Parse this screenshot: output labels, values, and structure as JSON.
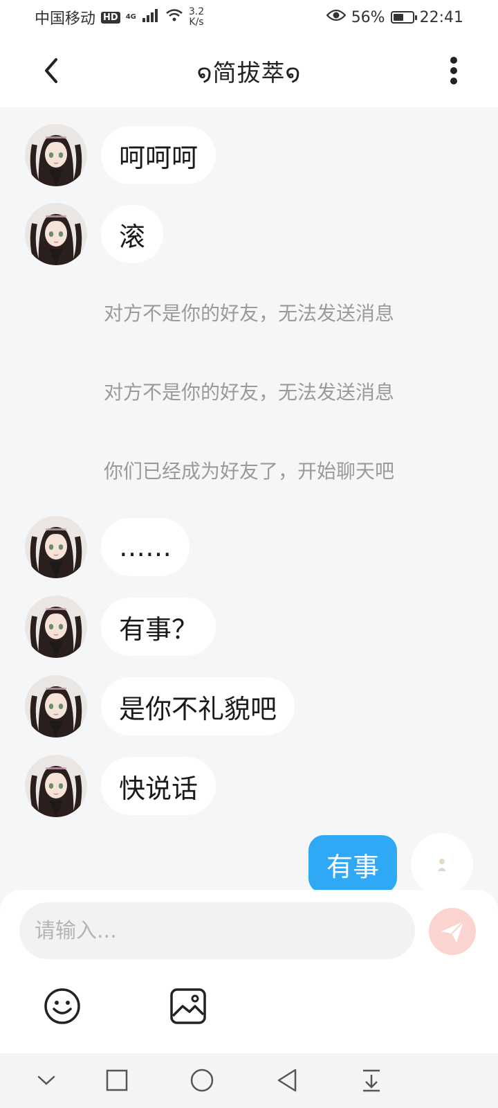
{
  "status_bar": {
    "carrier": "中国移动",
    "hd": "HD",
    "network": "4G",
    "speed_value": "3.2",
    "speed_unit": "K/s",
    "battery": "56%",
    "battery_level": 0.56,
    "time": "22:41"
  },
  "header": {
    "title": "໑简拔萃໑"
  },
  "messages": [
    {
      "type": "incoming",
      "text": "呵呵呵"
    },
    {
      "type": "incoming",
      "text": "滚"
    },
    {
      "type": "system",
      "text": "对方不是你的好友，无法发送消息"
    },
    {
      "type": "system",
      "text": "对方不是你的好友，无法发送消息"
    },
    {
      "type": "system",
      "text": "你们已经成为好友了，开始聊天吧"
    },
    {
      "type": "incoming",
      "text": "……"
    },
    {
      "type": "incoming",
      "text": "有事？"
    },
    {
      "type": "incoming",
      "text": "是你不礼貌吧"
    },
    {
      "type": "incoming",
      "text": "快说话"
    },
    {
      "type": "outgoing",
      "text": "有事"
    }
  ],
  "input": {
    "placeholder": "请输入..."
  },
  "icons": {
    "back": "chevron-left-icon",
    "more": "more-vertical-icon",
    "send": "send-icon",
    "emoji": "smiley-icon",
    "image": "image-icon",
    "nav_hide": "chevron-down-icon",
    "nav_recents": "square-icon",
    "nav_home": "circle-icon",
    "nav_back": "triangle-back-icon",
    "nav_notifications": "pull-down-icon"
  },
  "colors": {
    "outgoing_bubble": "#2fa8f5",
    "send_button": "#fbd3cf",
    "chat_background": "#f5f6f8"
  }
}
